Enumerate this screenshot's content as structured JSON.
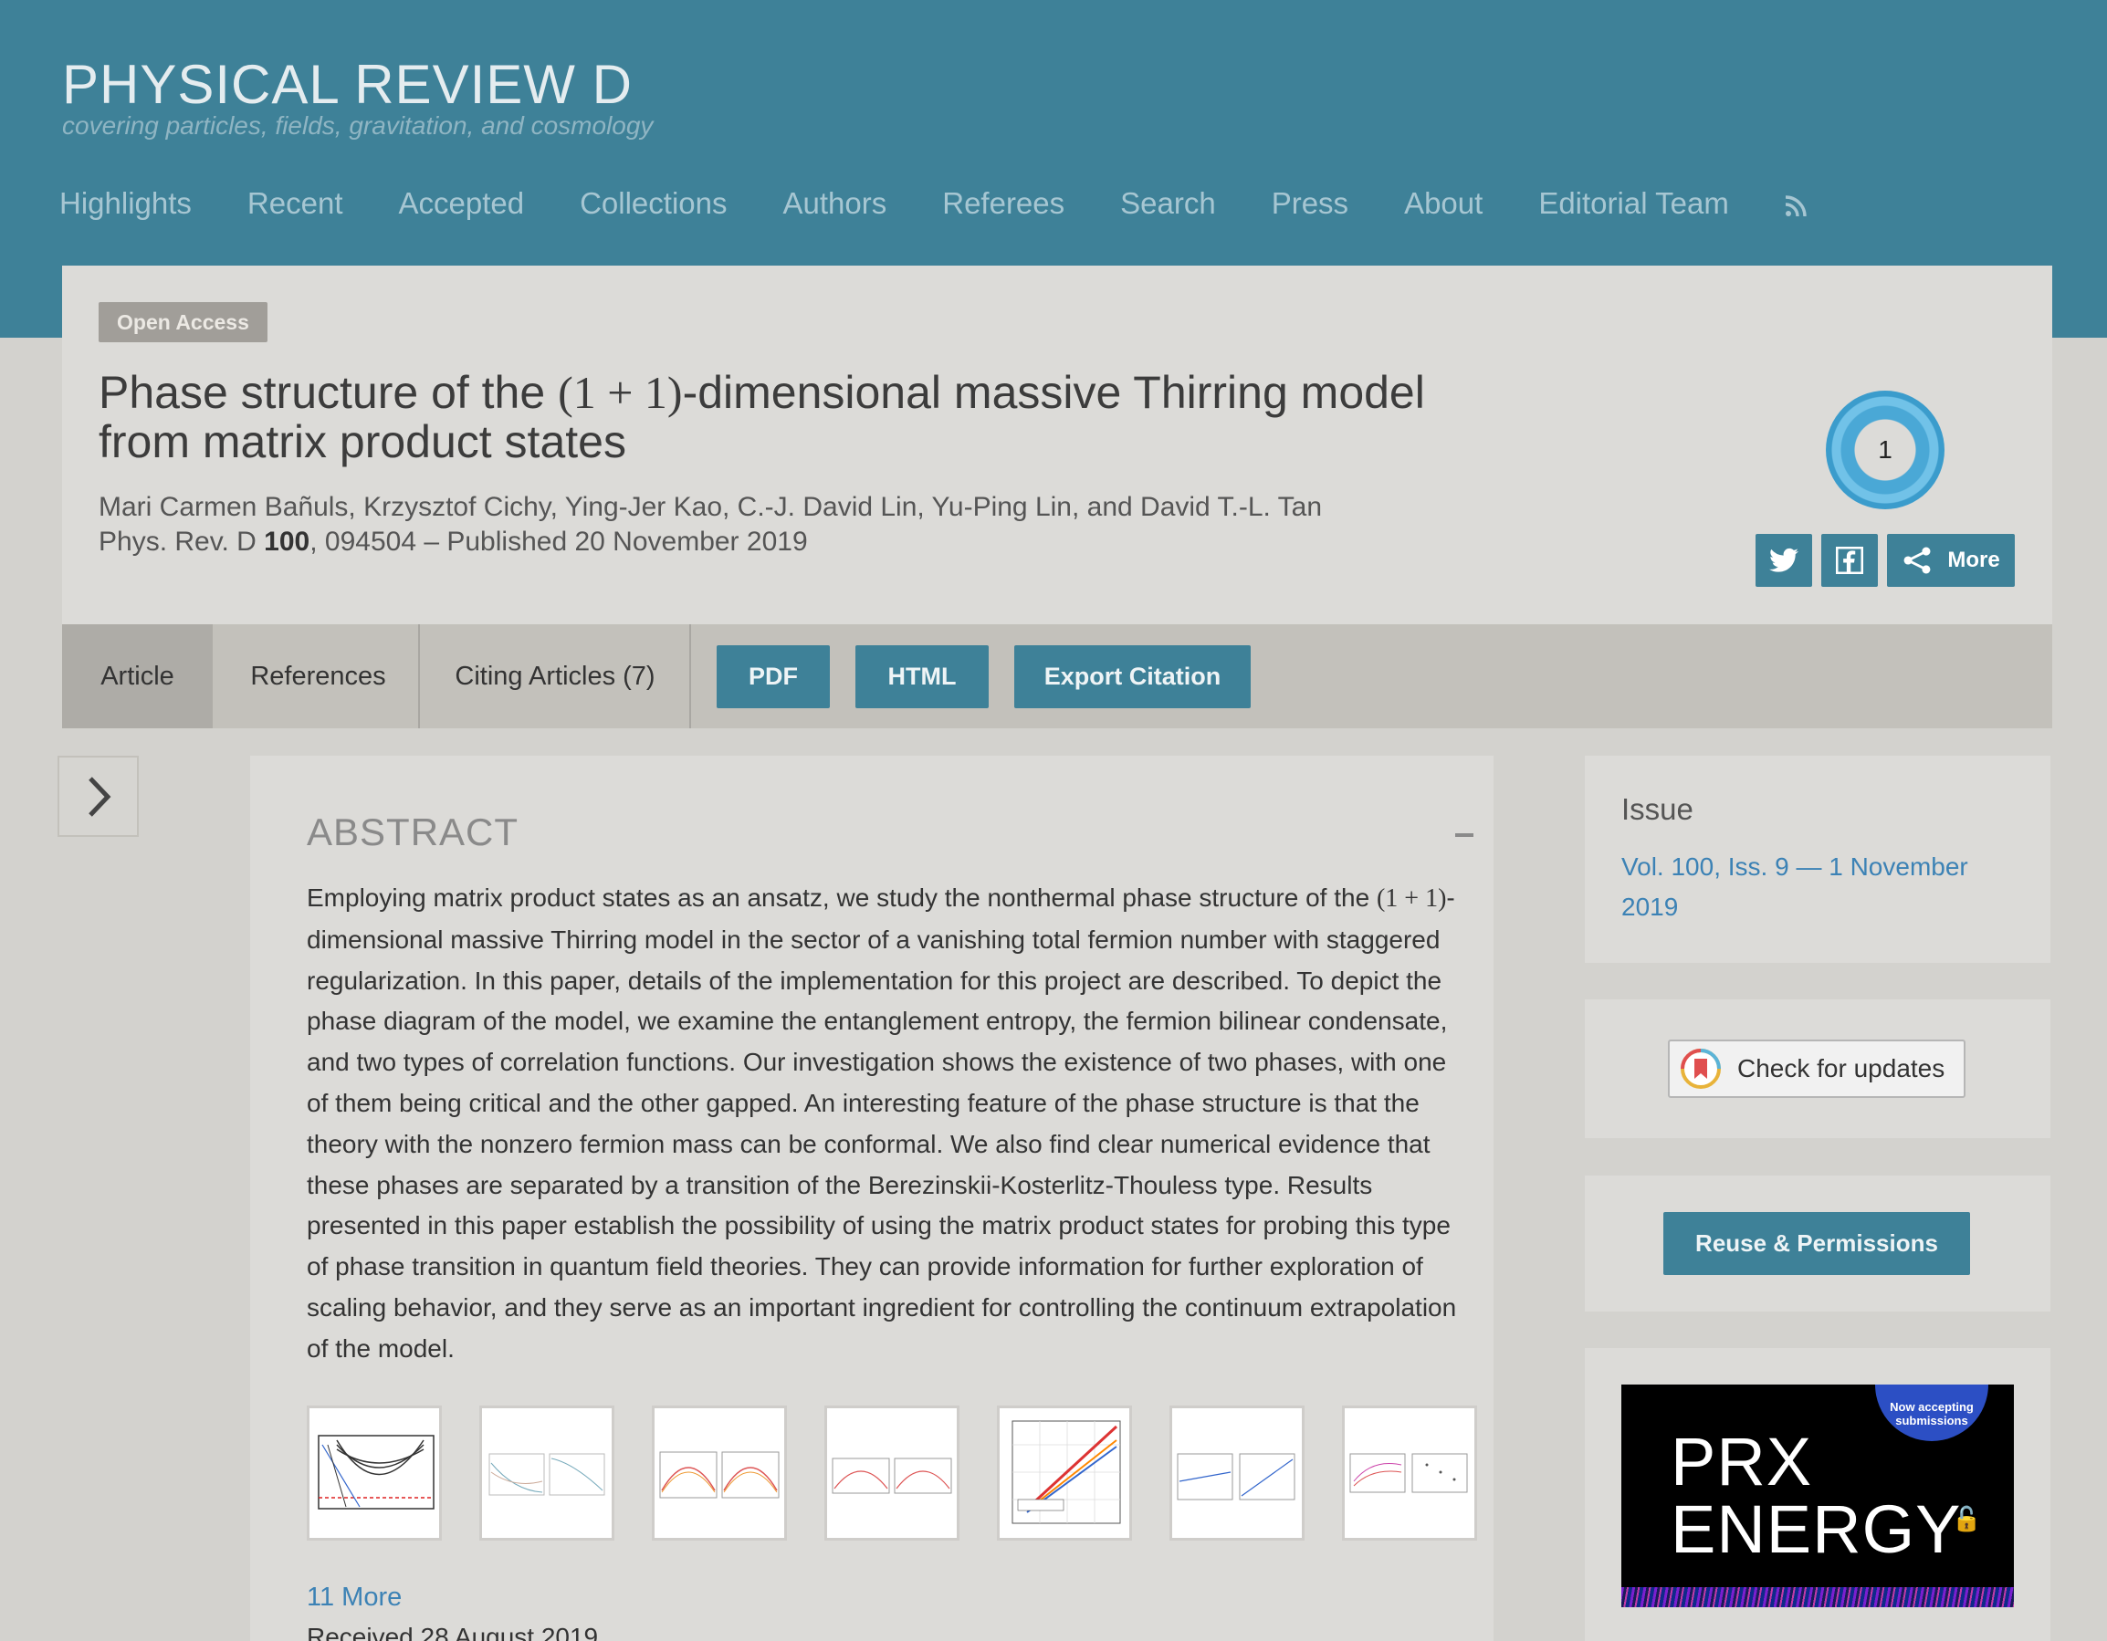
{
  "journal": {
    "title": "PHYSICAL REVIEW D",
    "subtitle": "covering particles, fields, gravitation, and cosmology"
  },
  "nav": {
    "items": [
      "Highlights",
      "Recent",
      "Accepted",
      "Collections",
      "Authors",
      "Referees",
      "Search",
      "Press",
      "About",
      "Editorial Team"
    ],
    "rss_icon": "rss-icon"
  },
  "article": {
    "access_badge": "Open Access",
    "title_pre": "Phase structure of the ",
    "title_math": "(1 + 1)",
    "title_post_line1": "-dimensional massive Thirring model",
    "title_line2": "from matrix product states",
    "authors": "Mari Carmen Bañuls, Krzysztof Cichy, Ying-Jer Kao, C.-J. David Lin, Yu-Ping Lin, and David T.-L. Tan",
    "journal_abbrev": "Phys. Rev. D ",
    "volume": "100",
    "pub_info": ", 094504 – Published 20 November 2019",
    "altmetric_score": "1"
  },
  "share": {
    "twitter_icon": "twitter-icon",
    "facebook_icon": "facebook-icon",
    "more_label": "More"
  },
  "tabs": {
    "article": "Article",
    "references": "References",
    "citing": "Citing Articles (7)",
    "pdf": "PDF",
    "html": "HTML",
    "export": "Export Citation"
  },
  "abstract": {
    "heading": "ABSTRACT",
    "text_pre": "Employing matrix product states as an ansatz, we study the nonthermal phase structure of the ",
    "text_math": "(1 + 1)",
    "text_post": "-dimensional massive Thirring model in the sector of a vanishing total fermion number with staggered regularization. In this paper, details of the implementation for this project are described. To depict the phase diagram of the model, we examine the entanglement entropy, the fermion bilinear condensate, and two types of correlation functions. Our investigation shows the existence of two phases, with one of them being critical and the other gapped. An interesting feature of the phase structure is that the theory with the nonzero fermion mass can be conformal. We also find clear numerical evidence that these phases are separated by a transition of the Berezinskii-Kosterlitz-Thouless type. Results presented in this paper establish the possibility of using the matrix product states for probing this type of phase transition in quantum field theories. They can provide information for further exploration of scaling behavior, and they serve as an important ingredient for controlling the continuum extrapolation of the model.",
    "more_figures": "11 More",
    "received": "Received 28 August 2019"
  },
  "sidebar": {
    "issue_label": "Issue",
    "issue_link": "Vol. 100, Iss. 9 — 1 November 2019",
    "check_updates": "Check for updates",
    "reuse": "Reuse & Permissions",
    "ad_badge": "Now accepting submissions",
    "ad_line1": "PRX",
    "ad_line2": "ENERGY"
  },
  "colors": {
    "brand": "#3e8198",
    "link": "#3c82b5",
    "background": "#d3d2ce"
  }
}
